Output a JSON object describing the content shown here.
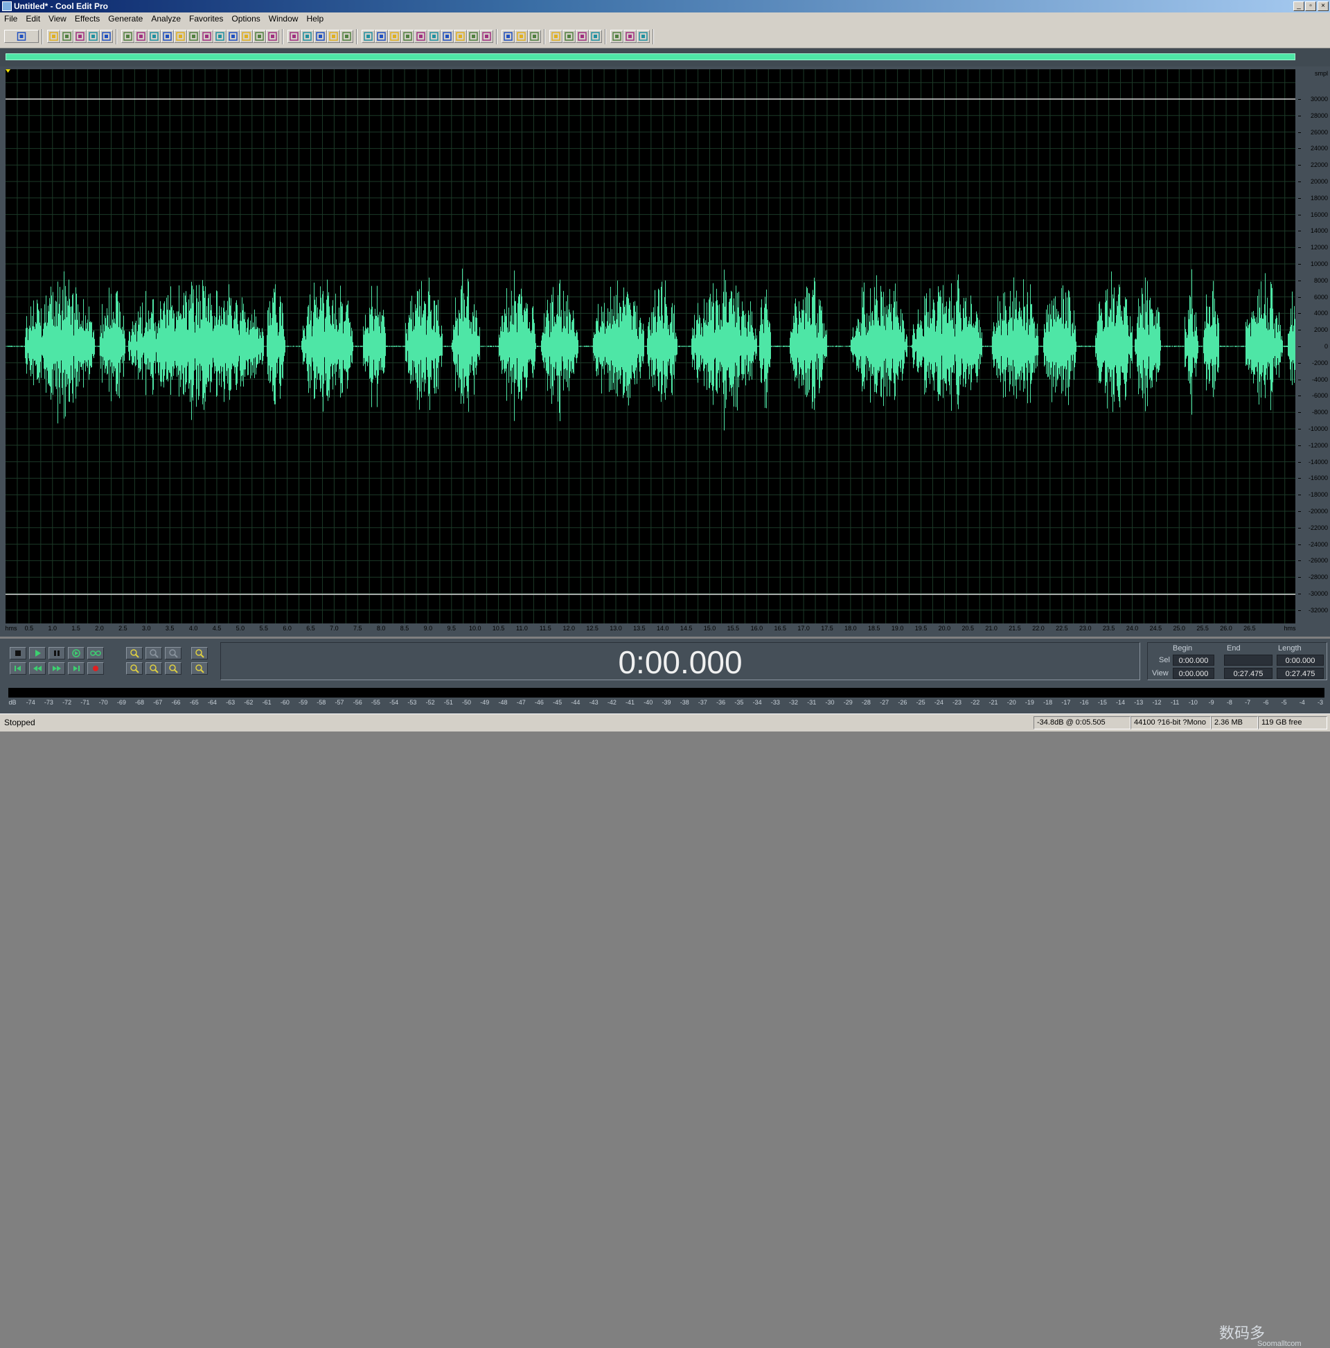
{
  "window": {
    "title": "Untitled* - Cool Edit Pro",
    "min": "_",
    "restore": "▫",
    "close": "×"
  },
  "menu": [
    "File",
    "Edit",
    "View",
    "Effects",
    "Generate",
    "Analyze",
    "Favorites",
    "Options",
    "Window",
    "Help"
  ],
  "toolbar": {
    "groups": [
      [
        "toggle-view-icon"
      ],
      [
        "new-file-icon",
        "open-file-icon",
        "save-file-icon",
        "save-as-icon",
        "close-file-icon"
      ],
      [
        "undo-icon",
        "redo-icon",
        "cut-icon",
        "copy-icon",
        "paste-icon",
        "paste-new-icon",
        "scissors-icon",
        "mix-paste-icon",
        "trim-icon",
        "insert-icon",
        "convert-icon",
        "loop-icon"
      ],
      [
        "envelope-icon",
        "normalize-icon",
        "grid1-icon",
        "grid2-icon",
        "grid3-icon"
      ],
      [
        "track-icon",
        "record-icon",
        "settings-icon",
        "play-icon",
        "zoom-box-icon",
        "sample-rate-icon",
        "bit-depth-icon",
        "spectrum-icon",
        "bars-icon",
        "metronome-icon"
      ],
      [
        "cd-icon",
        "script-icon",
        "help-icon"
      ],
      [
        "effect1-icon",
        "effect2-icon",
        "effect3-icon",
        "effect4-icon"
      ],
      [
        "tool1-icon",
        "tool2-icon",
        "tool3-icon"
      ]
    ]
  },
  "waveform": {
    "color": "#4ee6a6",
    "background": "#000000",
    "y_unit": "smpl",
    "y_labels": [
      "30000",
      "28000",
      "26000",
      "24000",
      "22000",
      "20000",
      "18000",
      "16000",
      "14000",
      "12000",
      "10000",
      "8000",
      "6000",
      "4000",
      "2000",
      "0",
      "-2000",
      "-4000",
      "-6000",
      "-8000",
      "-10000",
      "-12000",
      "-14000",
      "-16000",
      "-18000",
      "-20000",
      "-22000",
      "-24000",
      "-26000",
      "-28000",
      "-30000",
      "-32000"
    ],
    "time_unit": "hms",
    "time_labels": [
      "0.5",
      "1.0",
      "1.5",
      "2.0",
      "2.5",
      "3.0",
      "3.5",
      "4.0",
      "4.5",
      "5.0",
      "5.5",
      "6.0",
      "6.5",
      "7.0",
      "7.5",
      "8.0",
      "8.5",
      "9.0",
      "9.5",
      "10.0",
      "10.5",
      "11.0",
      "11.5",
      "12.0",
      "12.5",
      "13.0",
      "13.5",
      "14.0",
      "14.5",
      "15.0",
      "15.5",
      "16.0",
      "16.5",
      "17.0",
      "17.5",
      "18.0",
      "18.5",
      "19.0",
      "19.5",
      "20.0",
      "20.5",
      "21.0",
      "21.5",
      "22.0",
      "22.5",
      "23.0",
      "23.5",
      "24.0",
      "24.5",
      "25.0",
      "25.5",
      "26.0",
      "26.5"
    ],
    "bursts": [
      [
        0.4,
        1.9
      ],
      [
        2.0,
        2.55
      ],
      [
        2.6,
        5.5
      ],
      [
        5.55,
        5.95
      ],
      [
        6.3,
        7.4
      ],
      [
        7.6,
        8.1
      ],
      [
        8.5,
        9.3
      ],
      [
        9.5,
        10.1
      ],
      [
        10.5,
        11.3
      ],
      [
        11.4,
        12.2
      ],
      [
        12.5,
        13.6
      ],
      [
        13.65,
        14.3
      ],
      [
        14.6,
        16.0
      ],
      [
        16.05,
        16.3
      ],
      [
        16.7,
        17.5
      ],
      [
        18.0,
        19.2
      ],
      [
        19.3,
        20.8
      ],
      [
        21.0,
        22.0
      ],
      [
        22.1,
        22.8
      ],
      [
        23.2,
        24.0
      ],
      [
        24.05,
        24.6
      ],
      [
        25.1,
        25.4
      ],
      [
        25.5,
        25.85
      ],
      [
        26.4,
        27.2
      ],
      [
        27.3,
        27.9
      ]
    ]
  },
  "transport": {
    "time": "0:00.000",
    "sel_view": {
      "headers": {
        "begin": "Begin",
        "end": "End",
        "length": "Length"
      },
      "sel": {
        "label": "Sel",
        "begin": "0:00.000",
        "end": "",
        "length": "0:00.000"
      },
      "view": {
        "label": "View",
        "begin": "0:00.000",
        "end": "0:27.475",
        "length": "0:27.475"
      }
    },
    "db_labels": [
      "dB",
      "-74",
      "-73",
      "-72",
      "-71",
      "-70",
      "-69",
      "-68",
      "-67",
      "-66",
      "-65",
      "-64",
      "-63",
      "-62",
      "-61",
      "-60",
      "-59",
      "-58",
      "-57",
      "-56",
      "-55",
      "-54",
      "-53",
      "-52",
      "-51",
      "-50",
      "-49",
      "-48",
      "-47",
      "-46",
      "-45",
      "-44",
      "-43",
      "-42",
      "-41",
      "-40",
      "-39",
      "-38",
      "-37",
      "-36",
      "-35",
      "-34",
      "-33",
      "-32",
      "-31",
      "-30",
      "-29",
      "-28",
      "-27",
      "-26",
      "-25",
      "-24",
      "-23",
      "-22",
      "-21",
      "-20",
      "-19",
      "-18",
      "-17",
      "-16",
      "-15",
      "-14",
      "-13",
      "-12",
      "-11",
      "-10",
      "-9",
      "-8",
      "-7",
      "-6",
      "-5",
      "-4",
      "-3"
    ]
  },
  "status": {
    "state": "Stopped",
    "cursor": "-34.8dB @   0:05.505",
    "format": "44100 ?16-bit ?Mono",
    "size": "2.36 MB",
    "free": "119 GB free"
  },
  "watermark": {
    "main": "数码多",
    "sub": "Soomalltcom"
  }
}
